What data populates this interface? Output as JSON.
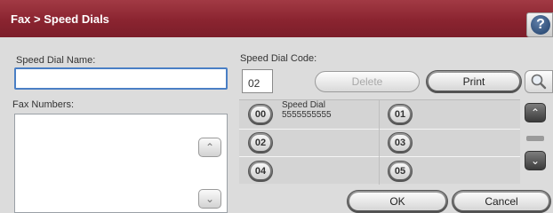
{
  "titlebar": {
    "title": "Fax > Speed Dials",
    "help_icon": "question-mark-icon",
    "help_glyph": "?"
  },
  "left": {
    "name_label": "Speed Dial Name:",
    "name_value": "",
    "fax_label": "Fax Numbers:",
    "fax_value": ""
  },
  "code": {
    "label": "Speed Dial Code:",
    "value": "02"
  },
  "buttons": {
    "delete": "Delete",
    "print": "Print",
    "search_icon": "magnifier-icon",
    "ok": "OK",
    "cancel": "Cancel"
  },
  "speed_dials": [
    {
      "code": "00",
      "name": "Speed Dial",
      "number": "5555555555"
    },
    {
      "code": "01",
      "name": "",
      "number": ""
    },
    {
      "code": "02",
      "name": "",
      "number": ""
    },
    {
      "code": "03",
      "name": "",
      "number": ""
    },
    {
      "code": "04",
      "name": "",
      "number": ""
    },
    {
      "code": "05",
      "name": "",
      "number": ""
    }
  ],
  "scroll": {
    "up_glyph": "⌃",
    "down_glyph": "⌄",
    "up_icon": "chevron-up-icon",
    "down_icon": "chevron-down-icon"
  },
  "colors": {
    "titlebar": "#8a2430",
    "input_focus": "#4a7fc5"
  }
}
